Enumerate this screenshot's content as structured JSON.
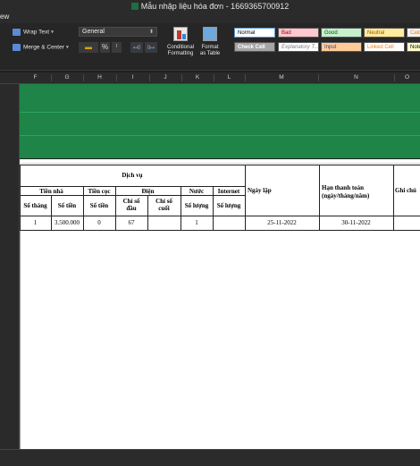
{
  "window": {
    "title": "Mẫu nhập liệu hóa đơn - 1669365700912"
  },
  "menubar": {
    "view_label": "ew"
  },
  "ribbon": {
    "wrap_text_label": "Wrap Text",
    "merge_center_label": "Merge & Center",
    "number_format": {
      "selected": "General"
    },
    "percent_label": "%",
    "comma_label": "⁾",
    "conditional_formatting_label_1": "Conditional",
    "conditional_formatting_label_2": "Formatting",
    "format_as_table_label_1": "Format",
    "format_as_table_label_2": "as Table",
    "cell_styles": [
      {
        "label": "Normal",
        "bg": "#ffffff",
        "fg": "#000000"
      },
      {
        "label": "Bad",
        "bg": "#ffc7ce",
        "fg": "#9c0006"
      },
      {
        "label": "Good",
        "bg": "#c6efce",
        "fg": "#006100"
      },
      {
        "label": "Neutral",
        "bg": "#ffeb9c",
        "fg": "#9c5700"
      },
      {
        "label": "Calcu",
        "bg": "#f2f2f2",
        "fg": "#fa7d00"
      },
      {
        "label": "Check Cell",
        "bg": "#a5a5a5",
        "fg": "#ffffff"
      },
      {
        "label": "Explanatory T...",
        "bg": "#ffffff",
        "fg": "#7f7f7f"
      },
      {
        "label": "Input",
        "bg": "#ffcc99",
        "fg": "#3f3f76"
      },
      {
        "label": "Linked Cell",
        "bg": "#ffffff",
        "fg": "#fa7d00"
      },
      {
        "label": "Note",
        "bg": "#ffffcc",
        "fg": "#000000"
      }
    ]
  },
  "columns": [
    "F",
    "G",
    "H",
    "I",
    "J",
    "K",
    "L",
    "M",
    "N",
    "O"
  ],
  "colors": {
    "accent_green": "#1e8448"
  },
  "table": {
    "dich_vu": "Dịch vụ",
    "groups": {
      "tien_nha": "Tiền nhà",
      "tien_coc": "Tiền cọc",
      "dien": "Điện",
      "nuoc": "Nước",
      "internet": "Internet"
    },
    "subheaders": {
      "so_thang": "Số tháng",
      "so_tien_1": "Số tiền",
      "so_tien_2": "Số tiền",
      "chi_so_dau_1": "Chỉ số",
      "chi_so_dau_2": "đầu",
      "chi_so_cuoi_1": "Chỉ số",
      "chi_so_cuoi_2": "cuối",
      "so_luong_1": "Số lượng",
      "so_luong_2": "Số lượng"
    },
    "ngay_lap": "Ngày lập",
    "han_thanh_toan_1": "Hạn thanh toán",
    "han_thanh_toan_2": "(ngày/tháng/năm)",
    "ghi_chu": "Ghi chú",
    "row": {
      "so_thang": "1",
      "so_tien": "3.500.000",
      "tien_coc": "0",
      "chi_so_dau": "67",
      "chi_so_cuoi": "",
      "nuoc": "1",
      "internet": "",
      "ngay_lap": "25-11-2022",
      "han_thanh_toan": "30-11-2022",
      "ghi_chu": ""
    }
  }
}
